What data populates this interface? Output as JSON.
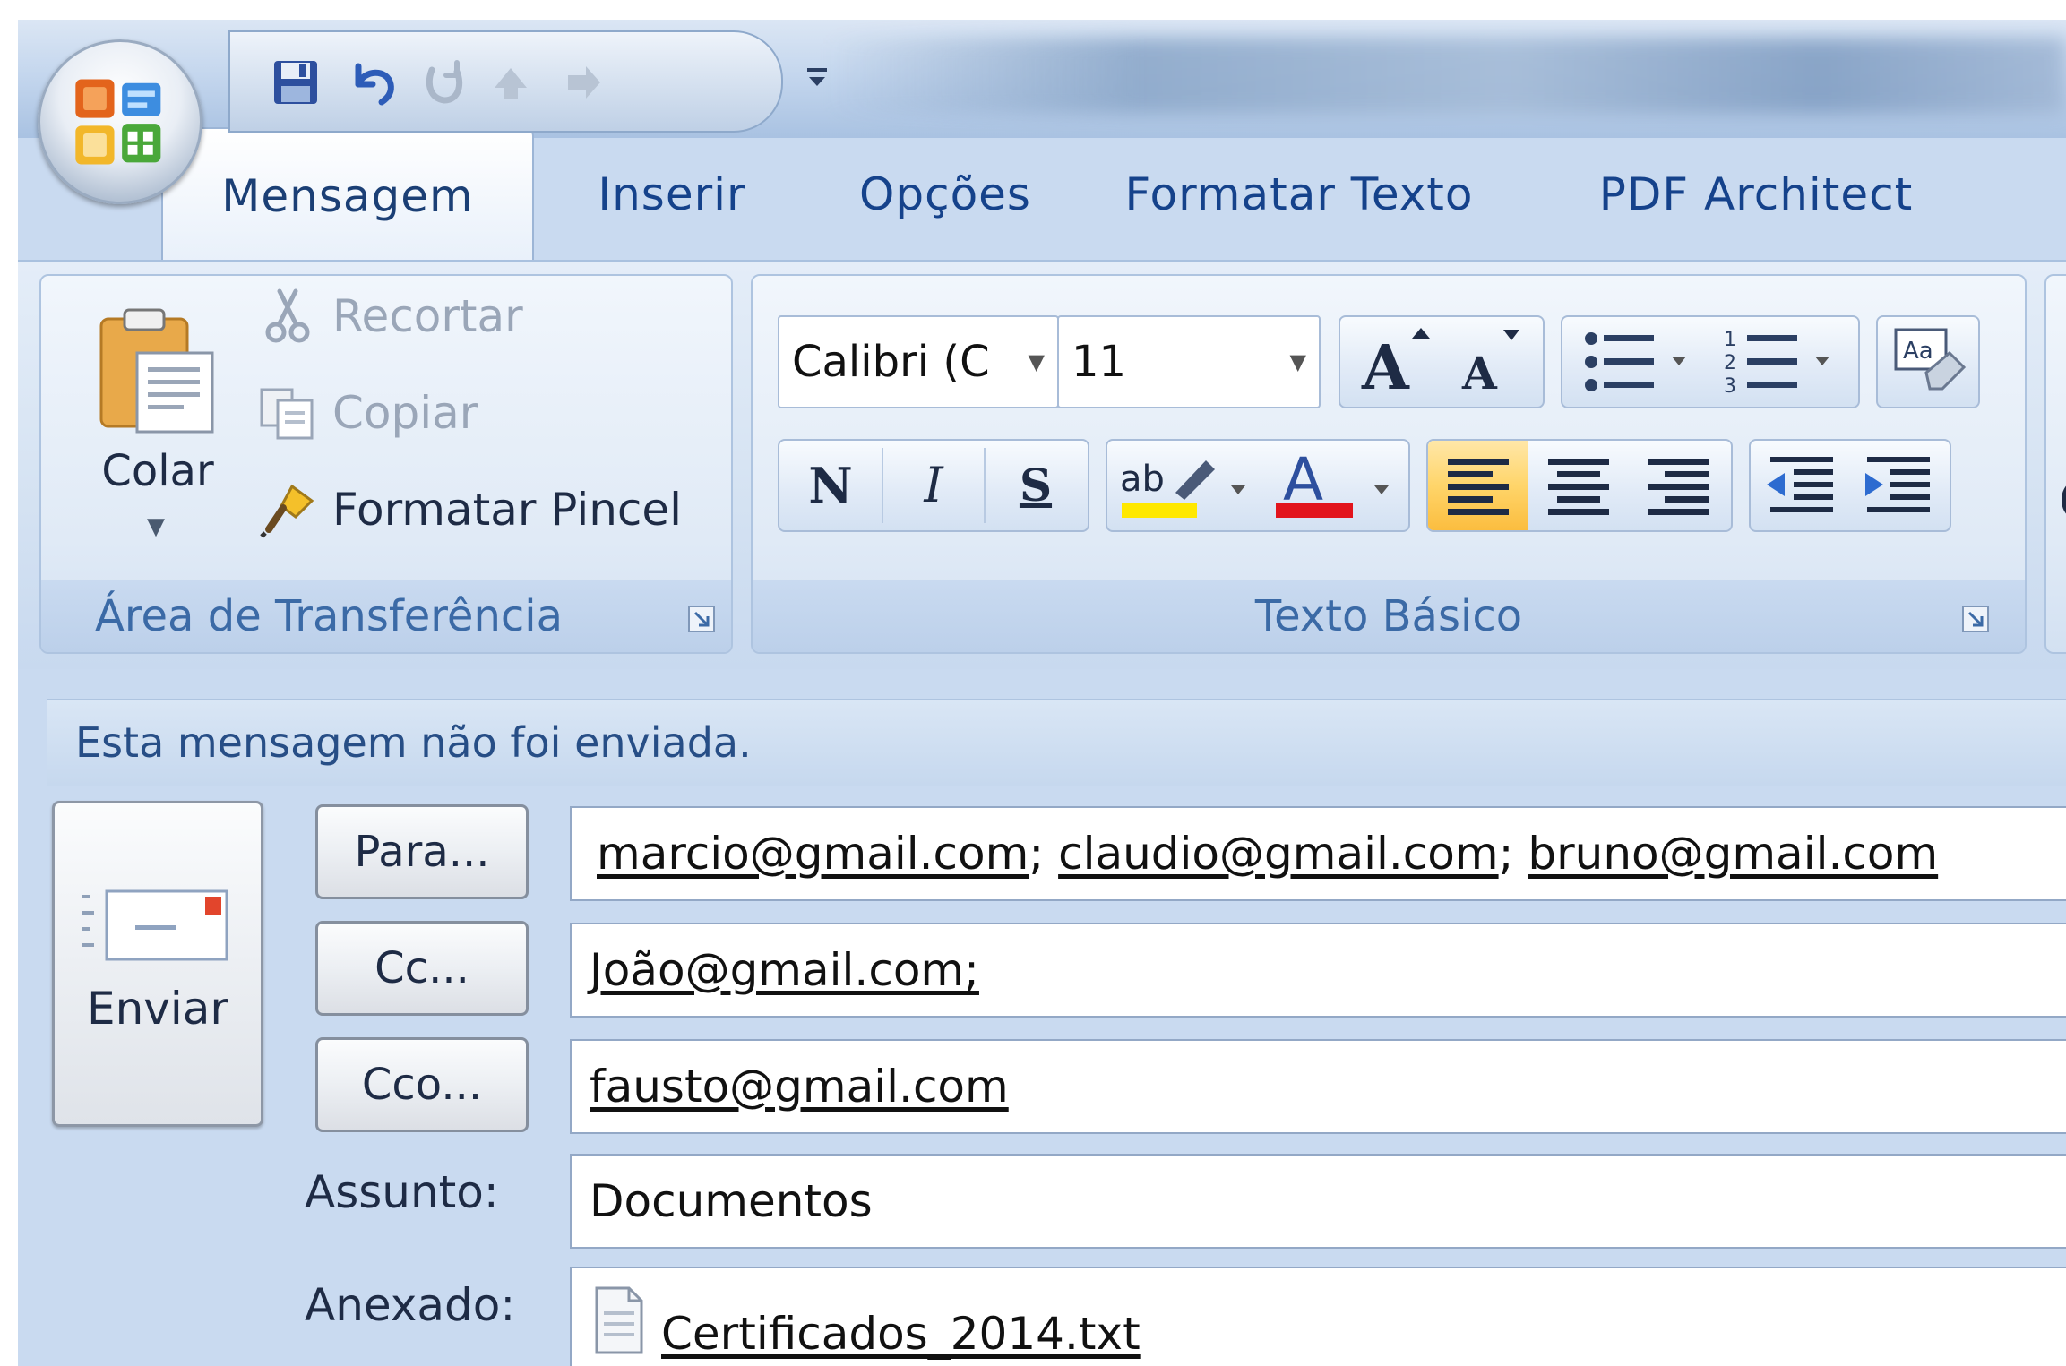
{
  "tabs": [
    {
      "label": "Mensagem",
      "active": true
    },
    {
      "label": "Inserir"
    },
    {
      "label": "Opções"
    },
    {
      "label": "Formatar Texto"
    },
    {
      "label": "PDF Architect"
    }
  ],
  "clipboard": {
    "paste_label": "Colar",
    "cut_label": "Recortar",
    "copy_label": "Copiar",
    "format_painter_label": "Formatar Pincel",
    "group_label": "Área de Transferência"
  },
  "basic_text": {
    "font_name": "Calibri (C",
    "font_size": "11",
    "bold_glyph": "N",
    "italic_glyph": "I",
    "underline_glyph": "S",
    "group_label": "Texto Básico",
    "highlight_color": "#ffe800",
    "font_color": "#e2141c"
  },
  "info_bar": {
    "text": "Esta mensagem não foi enviada."
  },
  "compose": {
    "send_label": "Enviar",
    "to_button": "Para...",
    "cc_button": "Cc...",
    "bcc_button": "Cco...",
    "to": [
      "marcio@gmail.com",
      "claudio@gmail.com",
      "bruno@gmail.com"
    ],
    "to_separator": ";",
    "cc": "João@gmail.com;",
    "bcc": "fausto@gmail.com",
    "subject_label": "Assunto:",
    "subject": "Documentos",
    "attached_label": "Anexado:",
    "attachment": "Certificados_2014.txt"
  },
  "icons": {
    "office_button": "office-logo-icon",
    "save": "floppy-disk-icon",
    "undo": "undo-icon",
    "redo": "redo-icon",
    "attachment": "text-file-icon"
  }
}
